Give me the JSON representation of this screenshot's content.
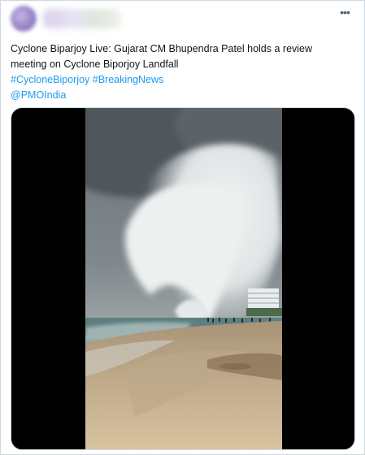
{
  "tweet": {
    "text_line1": "Cyclone Biparjoy Live: Gujarat CM Bhupendra Patel holds a review",
    "text_line2": "meeting on Cyclone Biporjoy Landfall",
    "hashtags": "#CycloneBiporjoy #BreakingNews",
    "mention": "@PMOIndia",
    "more_label": "•••"
  },
  "icons": {
    "more": "more-options-icon",
    "avatar": "blurred-avatar"
  },
  "colors": {
    "link": "#1d9bf0",
    "text": "#0f1419",
    "border": "#cfd9de",
    "media_bg": "#000000"
  }
}
